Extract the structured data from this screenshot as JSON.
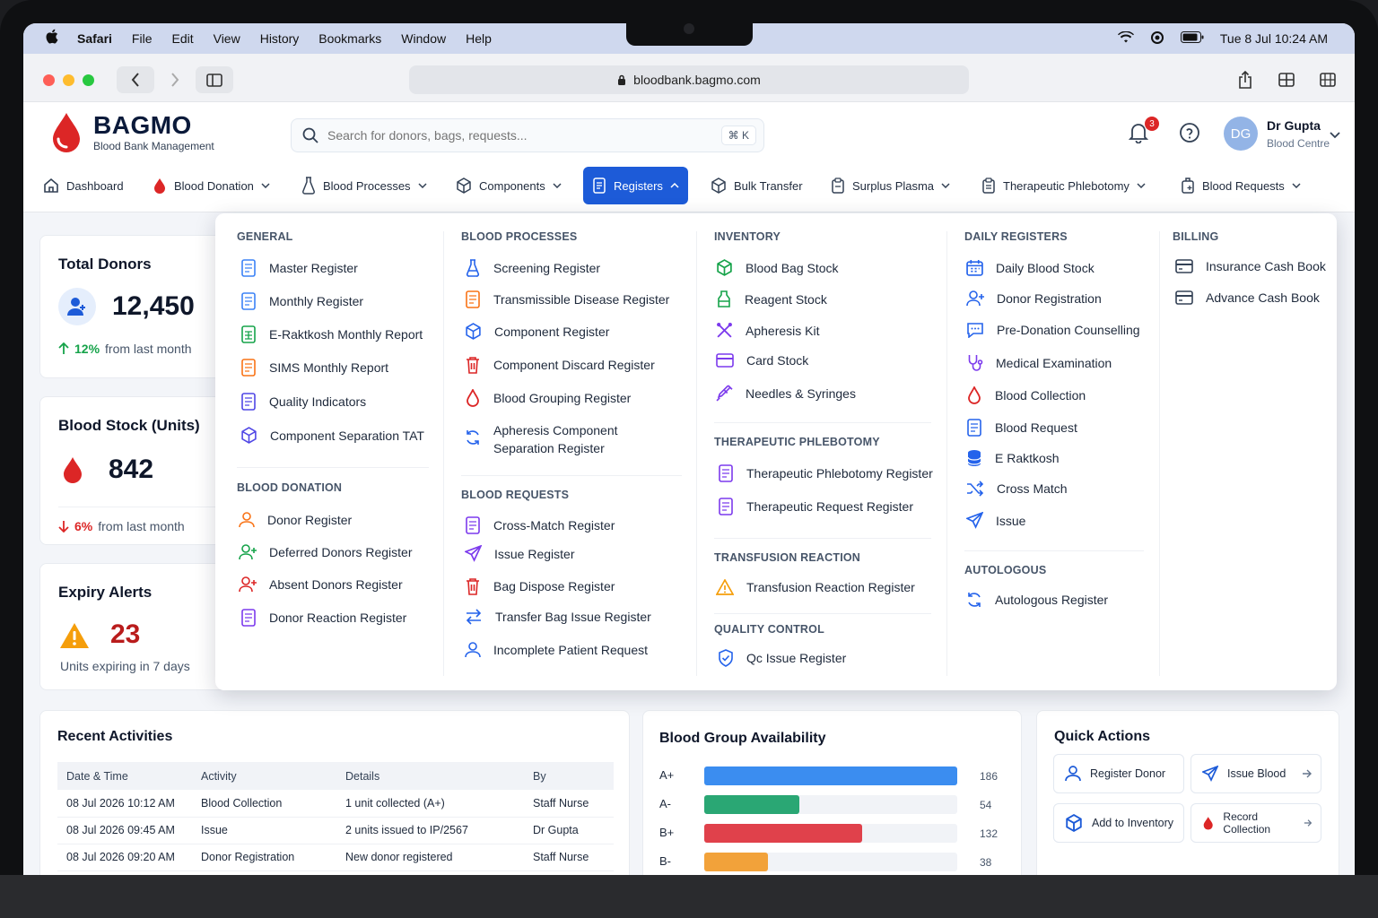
{
  "menubar": {
    "app": "Safari",
    "items": [
      "File",
      "Edit",
      "View",
      "History",
      "Bookmarks",
      "Window",
      "Help"
    ],
    "datetime": "Tue 8 Jul  10:24 AM"
  },
  "browser": {
    "url": "bloodbank.bagmo.com"
  },
  "brand": {
    "name": "BAGMO",
    "tagline": "Blood Bank Management",
    "accent": "#1d5bd8",
    "red": "#dc2626"
  },
  "search": {
    "placeholder": "Search for donors, bags, requests...",
    "shortcut": "⌘ K"
  },
  "notifications": {
    "count": "3"
  },
  "user": {
    "initials": "DG",
    "name": "Dr Gupta",
    "role": "Blood Centre"
  },
  "nav": [
    {
      "label": "Dashboard",
      "icon": "home-icon"
    },
    {
      "label": "Blood Donation",
      "icon": "blood-drop-icon"
    },
    {
      "label": "Blood Processes",
      "icon": "flask-icon"
    },
    {
      "label": "Components",
      "icon": "cube-icon"
    },
    {
      "label": "Registers",
      "icon": "register-icon"
    },
    {
      "label": "Bulk Transfer",
      "icon": "cube-icon"
    },
    {
      "label": "Surplus Plasma",
      "icon": "clipboard-icon"
    },
    {
      "label": "Therapeutic Phlebotomy",
      "icon": "clipboard-icon"
    },
    {
      "label": "Blood Requests",
      "icon": "bag-icon"
    }
  ],
  "stats": {
    "donors": {
      "title": "Total Donors",
      "value": "12,450",
      "change": "12%",
      "change_text": "from last month"
    },
    "stock": {
      "title": "Blood Stock (Units)",
      "value": "842",
      "change": "6%",
      "change_text": "from last month"
    },
    "expiry": {
      "title": "Expiry Alerts",
      "value": "23",
      "sub": "Units expiring in 7 days"
    }
  },
  "mega": {
    "general": {
      "title": "GENERAL",
      "items": [
        "Master Register",
        "Monthly Register",
        "E-Raktkosh Monthly Report",
        "SIMS Monthly Report",
        "Quality Indicators",
        "Component Separation TAT"
      ]
    },
    "blood_donation": {
      "title": "BLOOD DONATION",
      "items": [
        "Donor Register",
        "Deferred Donors Register",
        "Absent Donors Register",
        "Donor Reaction Register"
      ]
    },
    "blood_processes": {
      "title": "BLOOD PROCESSES",
      "items": [
        "Screening Register",
        "Transmissible Disease Register",
        "Component Register",
        "Component Discard Register",
        "Blood Grouping Register",
        "Apheresis Component",
        "Separation Register"
      ]
    },
    "blood_requests": {
      "title": "BLOOD REQUESTS",
      "items": [
        "Cross-Match Register",
        "Issue Register",
        "Bag Dispose Register",
        "Transfer Bag Issue Register",
        "Incomplete Patient Request"
      ]
    },
    "inventory": {
      "title": "INVENTORY",
      "items": [
        "Blood Bag Stock",
        "Reagent Stock",
        "Apheresis Kit",
        "Card Stock",
        "Needles & Syringes"
      ]
    },
    "therapeutic": {
      "title": "THERAPEUTIC PHLEBOTOMY",
      "items": [
        "Therapeutic Phlebotomy Register",
        "Therapeutic Request Register"
      ]
    },
    "transfusion": {
      "title": "TRANSFUSION REACTION",
      "items": [
        "Transfusion Reaction Register"
      ]
    },
    "quality": {
      "title": "QUALITY CONTROL",
      "items": [
        "Qc Issue Register"
      ]
    },
    "daily": {
      "title": "DAILY REGISTERS",
      "items": [
        "Daily Blood Stock",
        "Donor Registration",
        "Pre-Donation Counselling",
        "Medical Examination",
        "Blood Collection",
        "Blood Request",
        "E Raktkosh",
        "Cross Match",
        "Issue"
      ]
    },
    "autologous": {
      "title": "AUTOLOGOUS",
      "items": [
        "Autologous Register"
      ]
    },
    "billing": {
      "title": "BILLING",
      "items": [
        "Insurance Cash Book",
        "Advance Cash Book"
      ]
    }
  },
  "activities": {
    "title": "Recent Activities",
    "columns": [
      "Date & Time",
      "Activity",
      "Details",
      "By"
    ],
    "rows": [
      [
        "08 Jul 2026 10:12 AM",
        "Blood Collection",
        "1 unit collected (A+)",
        "Staff Nurse"
      ],
      [
        "08 Jul 2026 09:45 AM",
        "Issue",
        "2 units issued to IP/2567",
        "Dr Gupta"
      ],
      [
        "08 Jul 2026 09:20 AM",
        "Donor Registration",
        "New donor registered",
        "Staff Nurse"
      ]
    ]
  },
  "availability": {
    "title": "Blood Group Availability",
    "groups": [
      {
        "group": "A+",
        "units": "186",
        "fraction": 1.0,
        "color": "#3b8df0"
      },
      {
        "group": "A-",
        "units": "54",
        "fraction": 0.376,
        "color": "#2aa774"
      },
      {
        "group": "B+",
        "units": "132",
        "fraction": 0.625,
        "color": "#e0414b"
      },
      {
        "group": "B-",
        "units": "38",
        "fraction": 0.25,
        "color": "#f2a23a"
      }
    ]
  },
  "quick_actions": {
    "title": "Quick Actions",
    "items": [
      {
        "label": "Register Donor",
        "icon": "user-icon"
      },
      {
        "label": "Issue Blood",
        "icon": "send-icon"
      },
      {
        "label": "Add to Inventory",
        "icon": "cube-icon"
      },
      {
        "label": "Record Collection",
        "icon": "blood-drop-icon"
      }
    ]
  }
}
